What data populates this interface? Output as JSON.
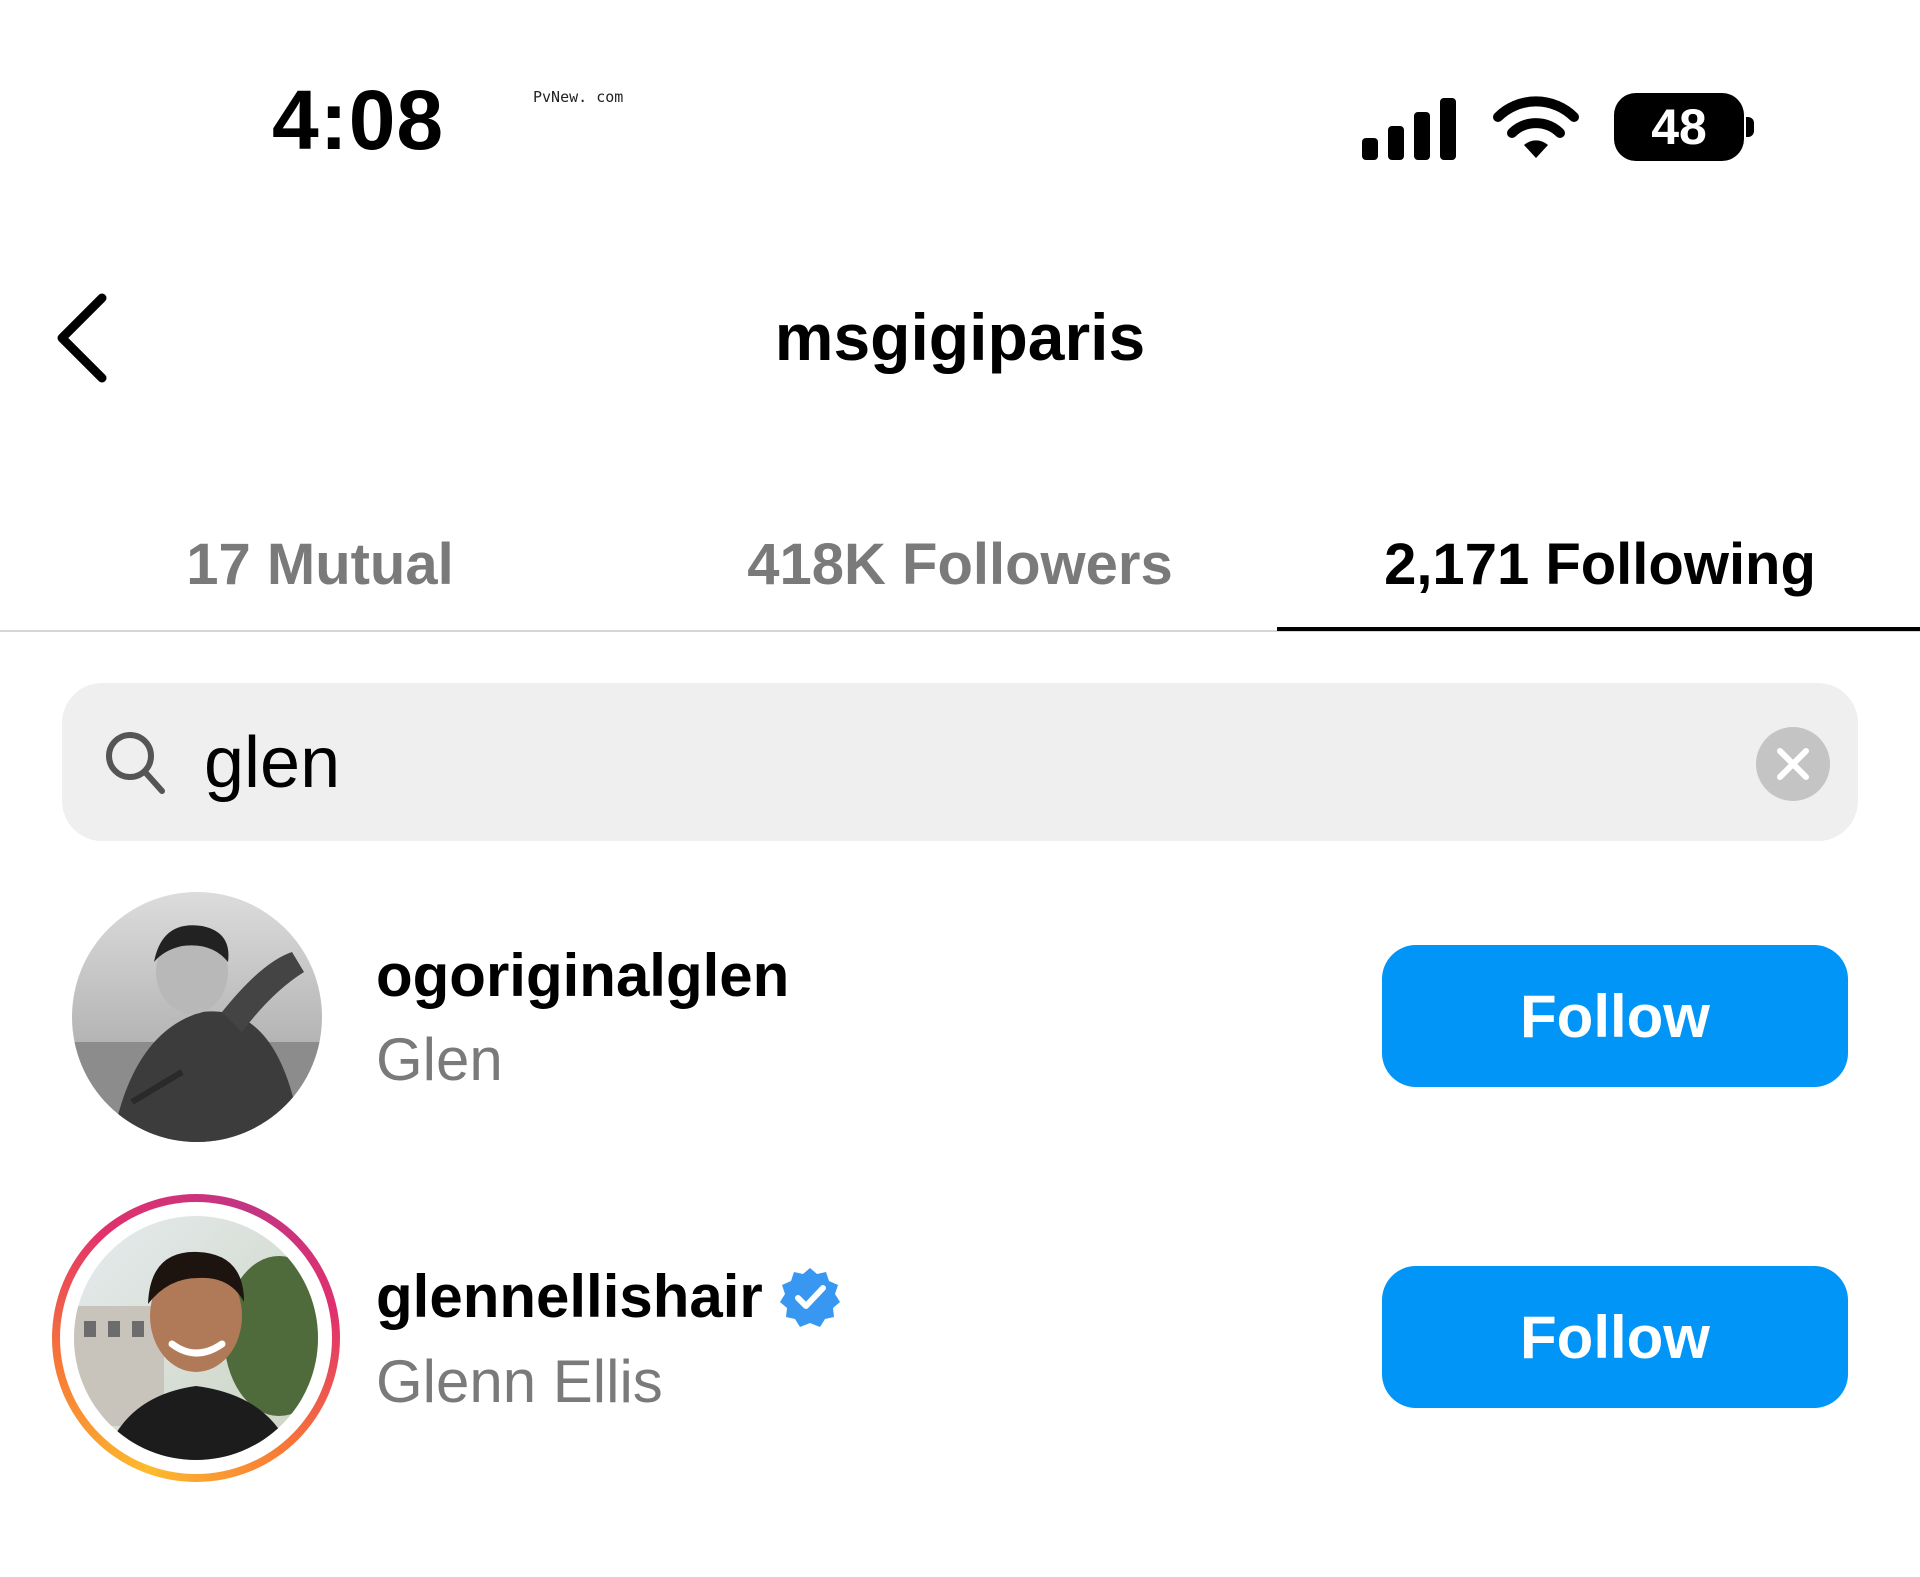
{
  "status_bar": {
    "time": "4:08",
    "watermark": "PvNew. com",
    "battery": "48",
    "icons": [
      "signal-icon",
      "wifi-icon",
      "battery-icon"
    ]
  },
  "header": {
    "back_icon": "chevron-left-icon",
    "title": "msgigiparis"
  },
  "tabs": [
    {
      "label": "17 Mutual",
      "active": false
    },
    {
      "label": "418K Followers",
      "active": false
    },
    {
      "label": "2,171 Following",
      "active": true
    }
  ],
  "search": {
    "icon": "search-icon",
    "value": "glen",
    "clear_icon": "close-icon"
  },
  "results": [
    {
      "username": "ogoriginalglen",
      "full_name": "Glen",
      "verified": false,
      "has_story_ring": false,
      "button_label": "Follow"
    },
    {
      "username": "glennellishair",
      "full_name": "Glenn Ellis",
      "verified": true,
      "has_story_ring": true,
      "button_label": "Follow"
    }
  ],
  "colors": {
    "accent": "#0095f6",
    "verified": "#3897f0",
    "muted_text": "#7a7a7a",
    "search_bg": "#efefef"
  }
}
